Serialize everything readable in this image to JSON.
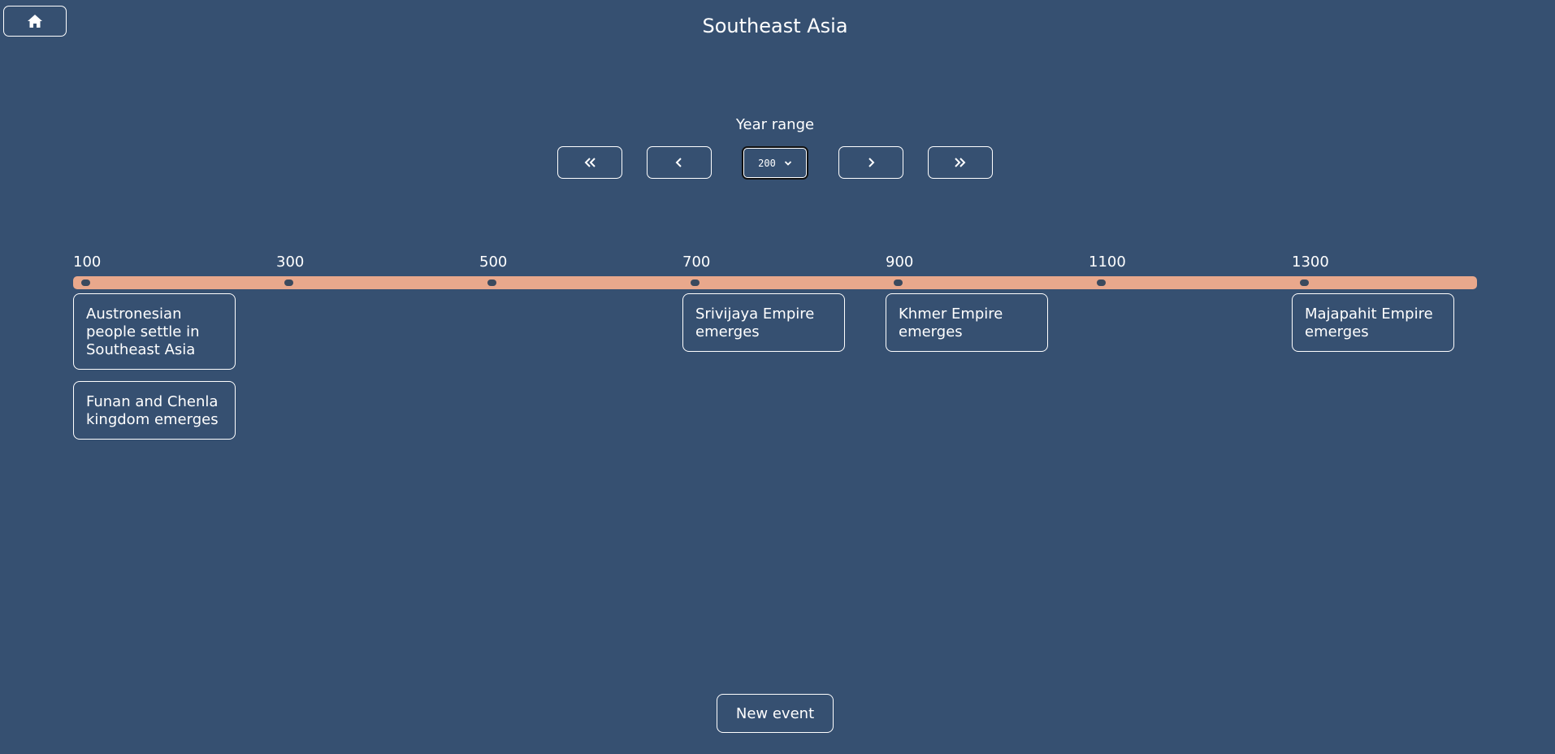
{
  "header": {
    "title": "Southeast Asia",
    "home_icon": "home-icon"
  },
  "range": {
    "label": "Year range",
    "selected": "200",
    "icons": {
      "first": "double-chevron-left-icon",
      "prev": "chevron-left-icon",
      "next": "chevron-right-icon",
      "last": "double-chevron-right-icon"
    }
  },
  "timeline": {
    "years": [
      "100",
      "300",
      "500",
      "700",
      "900",
      "1100",
      "1300"
    ]
  },
  "events": [
    {
      "text": "Austronesian people settle in Southeast Asia",
      "year": 100
    },
    {
      "text": "Funan and Chenla kingdom emerges",
      "year": 100
    },
    {
      "text": "Srivijaya Empire emerges",
      "year": 700
    },
    {
      "text": "Khmer Empire emerges",
      "year": 900
    },
    {
      "text": "Majapahit Empire emerges",
      "year": 1300
    }
  ],
  "footer": {
    "new_event_label": "New event"
  },
  "colors": {
    "background": "#365071",
    "timeline_bar": "#e9a88c",
    "marker": "#3b4a5e"
  }
}
